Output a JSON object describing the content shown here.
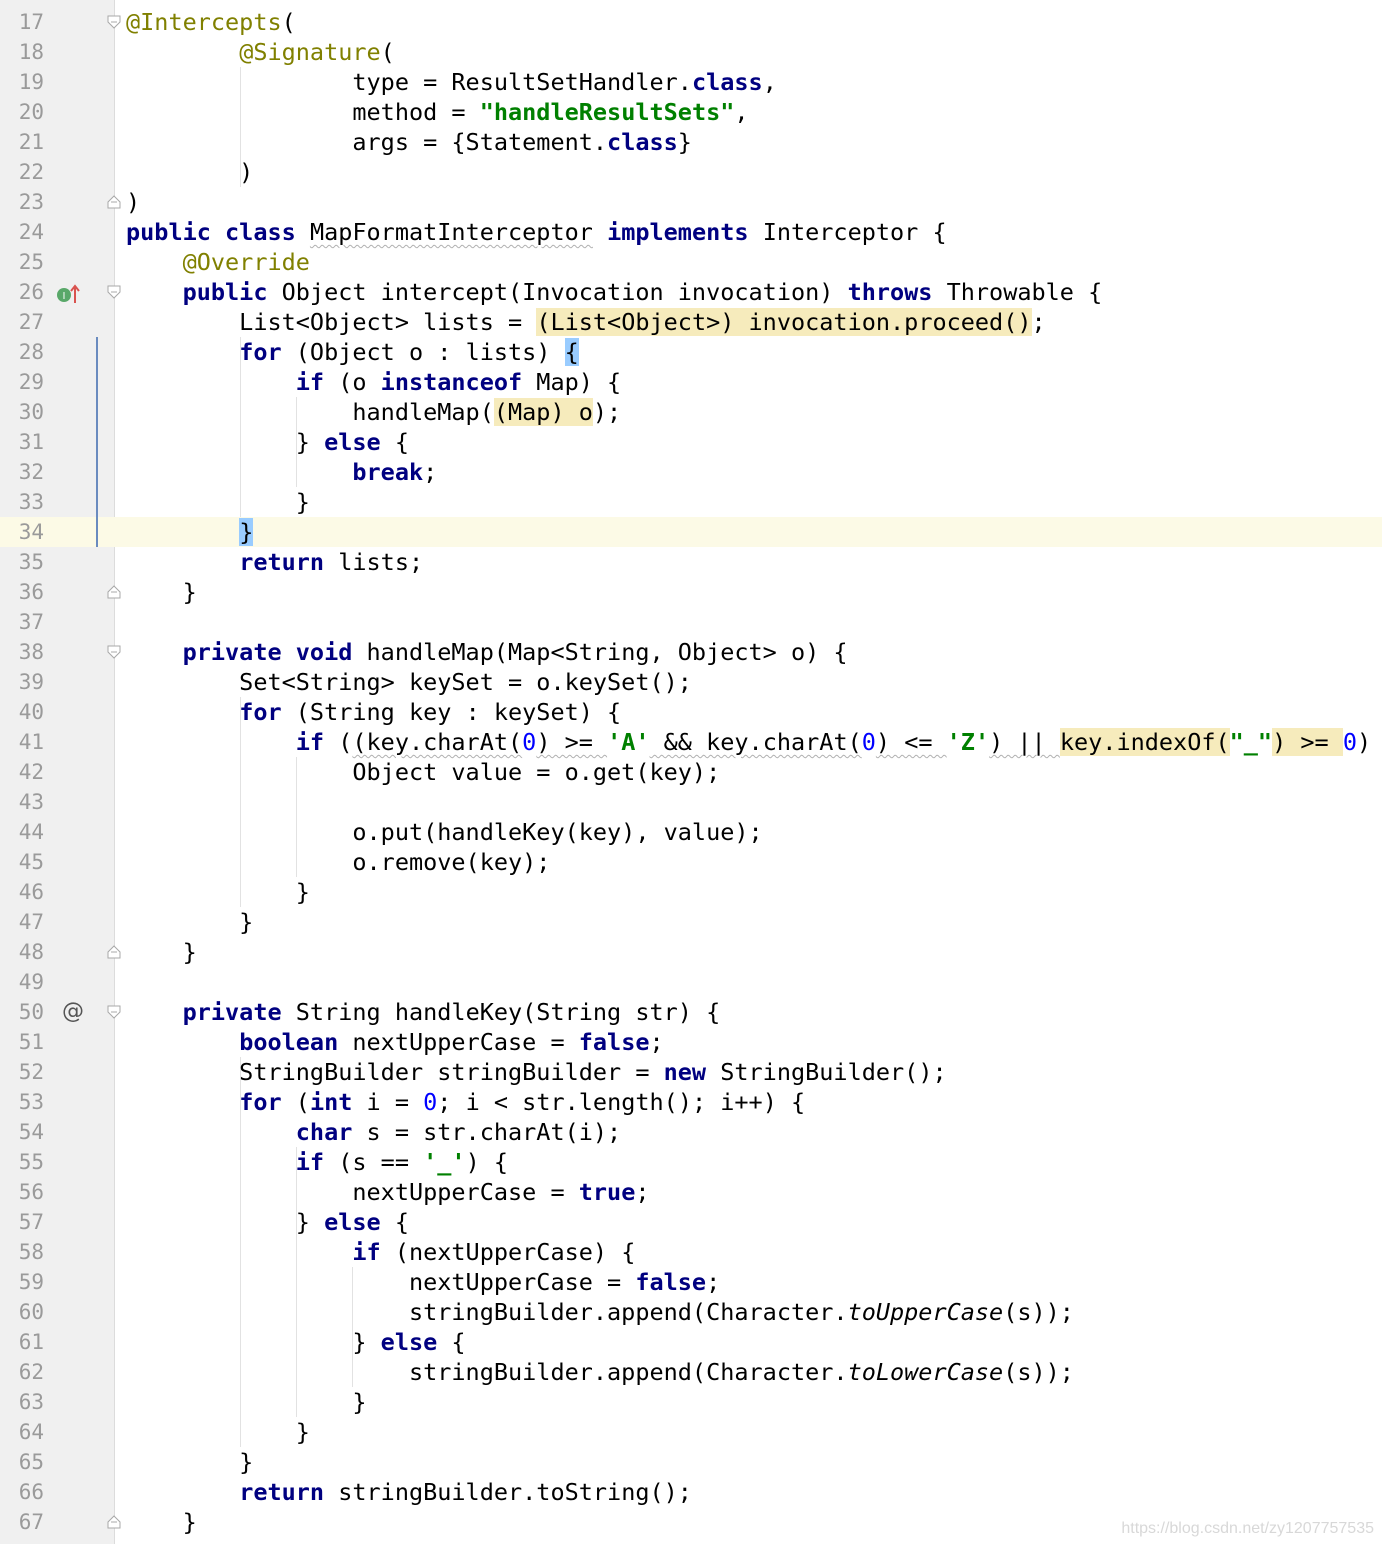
{
  "editor": {
    "first_line": 17,
    "current_line": 34,
    "lines": [
      [
        [
          "ann",
          "@Intercepts"
        ],
        [
          "",
          "("
        ]
      ],
      [
        [
          "",
          "        "
        ],
        [
          "ann",
          "@Signature"
        ],
        [
          "",
          "("
        ]
      ],
      [
        [
          "",
          "                type = ResultSetHandler."
        ],
        [
          "kw",
          "class"
        ],
        [
          "",
          ","
        ]
      ],
      [
        [
          "",
          "                method = "
        ],
        [
          "str",
          "\"handleResultSets\""
        ],
        [
          "",
          ","
        ]
      ],
      [
        [
          "",
          "                args = {Statement."
        ],
        [
          "kw",
          "class"
        ],
        [
          "",
          "}"
        ]
      ],
      [
        [
          "",
          "        )"
        ]
      ],
      [
        [
          "",
          ")"
        ]
      ],
      [
        [
          "kw",
          "public class"
        ],
        [
          "",
          " "
        ],
        [
          "squig",
          "MapFormatInterceptor"
        ],
        [
          "",
          " "
        ],
        [
          "kw",
          "implements"
        ],
        [
          "",
          " Interceptor {"
        ]
      ],
      [
        [
          "",
          "    "
        ],
        [
          "ann",
          "@Override"
        ]
      ],
      [
        [
          "",
          "    "
        ],
        [
          "kw",
          "public"
        ],
        [
          "",
          " Object intercept(Invocation invocation) "
        ],
        [
          "kw",
          "throws"
        ],
        [
          "",
          " Throwable {"
        ]
      ],
      [
        [
          "",
          "        List<Object> lists = "
        ],
        [
          "hl",
          "(List<Object>) invocation.proceed()"
        ],
        [
          "",
          ";"
        ]
      ],
      [
        [
          "",
          "        "
        ],
        [
          "kw",
          "for"
        ],
        [
          "",
          " (Object o : lists) "
        ],
        [
          "brace-match",
          "{"
        ]
      ],
      [
        [
          "",
          "            "
        ],
        [
          "kw",
          "if"
        ],
        [
          "",
          " (o "
        ],
        [
          "kw",
          "instanceof"
        ],
        [
          "",
          " Map) {"
        ]
      ],
      [
        [
          "",
          "                handleMap("
        ],
        [
          "hl",
          "(Map) o"
        ],
        [
          "",
          ");"
        ]
      ],
      [
        [
          "",
          "            } "
        ],
        [
          "kw",
          "else"
        ],
        [
          "",
          " {"
        ]
      ],
      [
        [
          "",
          "                "
        ],
        [
          "kw",
          "break"
        ],
        [
          "",
          ";"
        ]
      ],
      [
        [
          "",
          "            }"
        ]
      ],
      [
        [
          "",
          "        "
        ],
        [
          "brace-match",
          "}"
        ]
      ],
      [
        [
          "",
          "        "
        ],
        [
          "kw",
          "return"
        ],
        [
          "",
          " lists;"
        ]
      ],
      [
        [
          "",
          "    }"
        ]
      ],
      [
        [
          "",
          ""
        ]
      ],
      [
        [
          "",
          "    "
        ],
        [
          "kw",
          "private void"
        ],
        [
          "",
          " handleMap(Map<String, Object> o) {"
        ]
      ],
      [
        [
          "",
          "        Set<String> keySet = o.keySet();"
        ]
      ],
      [
        [
          "",
          "        "
        ],
        [
          "kw",
          "for"
        ],
        [
          "",
          " (String key : keySet) {"
        ]
      ],
      [
        [
          "",
          "            "
        ],
        [
          "kw",
          "if"
        ],
        [
          "",
          " ("
        ],
        [
          "squig",
          "(key.charAt("
        ],
        [
          "num",
          "0"
        ],
        [
          "squig",
          ") >= "
        ],
        [
          "str",
          "'A'"
        ],
        [
          "squig",
          " && key.charAt("
        ],
        [
          "num",
          "0"
        ],
        [
          "squig",
          ") <= "
        ],
        [
          "str",
          "'Z'"
        ],
        [
          "squig",
          ") || "
        ],
        [
          "hl",
          "key.indexOf("
        ],
        [
          "str",
          "\"_\""
        ],
        [
          "hl",
          ") >= "
        ],
        [
          "num",
          "0"
        ],
        [
          "",
          ") {"
        ]
      ],
      [
        [
          "",
          "                Object value = o.get(key);"
        ]
      ],
      [
        [
          "",
          ""
        ]
      ],
      [
        [
          "",
          "                o.put(handleKey(key), value);"
        ]
      ],
      [
        [
          "",
          "                o.remove(key);"
        ]
      ],
      [
        [
          "",
          "            }"
        ]
      ],
      [
        [
          "",
          "        }"
        ]
      ],
      [
        [
          "",
          "    }"
        ]
      ],
      [
        [
          "",
          ""
        ]
      ],
      [
        [
          "",
          "    "
        ],
        [
          "kw",
          "private"
        ],
        [
          "",
          " String handleKey(String str) {"
        ]
      ],
      [
        [
          "",
          "        "
        ],
        [
          "kw",
          "boolean"
        ],
        [
          "",
          " nextUpperCase = "
        ],
        [
          "kw",
          "false"
        ],
        [
          "",
          ";"
        ]
      ],
      [
        [
          "",
          "        StringBuilder stringBuilder = "
        ],
        [
          "kw",
          "new"
        ],
        [
          "",
          " StringBuilder();"
        ]
      ],
      [
        [
          "",
          "        "
        ],
        [
          "kw",
          "for"
        ],
        [
          "",
          " ("
        ],
        [
          "kw",
          "int"
        ],
        [
          "",
          " i = "
        ],
        [
          "num",
          "0"
        ],
        [
          "",
          "; i < str.length(); i++) {"
        ]
      ],
      [
        [
          "",
          "            "
        ],
        [
          "kw",
          "char"
        ],
        [
          "",
          " s = str.charAt(i);"
        ]
      ],
      [
        [
          "",
          "            "
        ],
        [
          "kw",
          "if"
        ],
        [
          "",
          " (s == "
        ],
        [
          "str",
          "'_'"
        ],
        [
          "",
          ") {"
        ]
      ],
      [
        [
          "",
          "                nextUpperCase = "
        ],
        [
          "kw",
          "true"
        ],
        [
          "",
          ";"
        ]
      ],
      [
        [
          "",
          "            } "
        ],
        [
          "kw",
          "else"
        ],
        [
          "",
          " {"
        ]
      ],
      [
        [
          "",
          "                "
        ],
        [
          "kw",
          "if"
        ],
        [
          "",
          " (nextUpperCase) {"
        ]
      ],
      [
        [
          "",
          "                    nextUpperCase = "
        ],
        [
          "kw",
          "false"
        ],
        [
          "",
          ";"
        ]
      ],
      [
        [
          "",
          "                    stringBuilder.append(Character."
        ],
        [
          "it",
          "toUpperCase"
        ],
        [
          "",
          "(s));"
        ]
      ],
      [
        [
          "",
          "                } "
        ],
        [
          "kw",
          "else"
        ],
        [
          "",
          " {"
        ]
      ],
      [
        [
          "",
          "                    stringBuilder.append(Character."
        ],
        [
          "it",
          "toLowerCase"
        ],
        [
          "",
          "(s));"
        ]
      ],
      [
        [
          "",
          "                }"
        ]
      ],
      [
        [
          "",
          "            }"
        ]
      ],
      [
        [
          "",
          "        }"
        ]
      ],
      [
        [
          "",
          "        "
        ],
        [
          "kw",
          "return"
        ],
        [
          "",
          " stringBuilder.toString();"
        ]
      ],
      [
        [
          "",
          "    }"
        ]
      ]
    ]
  },
  "gutter": {
    "override_marker_line": 26,
    "override_marker_label": "I",
    "at_marker_line": 50,
    "at_marker_text": "@",
    "fold_open_lines": [
      17,
      26,
      38,
      50
    ],
    "fold_close_lines": [
      23,
      36,
      48,
      67
    ],
    "vcs_change_lines": [
      28,
      34
    ]
  },
  "watermark": {
    "text": "https://blog.csdn.net/zy1207757535"
  },
  "colors": {
    "keyword": "#000080",
    "string": "#008000",
    "number": "#0000ff",
    "annotation": "#808000",
    "highlight": "#f6ebbc",
    "brace_match": "#99ccff",
    "current_line": "#fcfae6"
  }
}
